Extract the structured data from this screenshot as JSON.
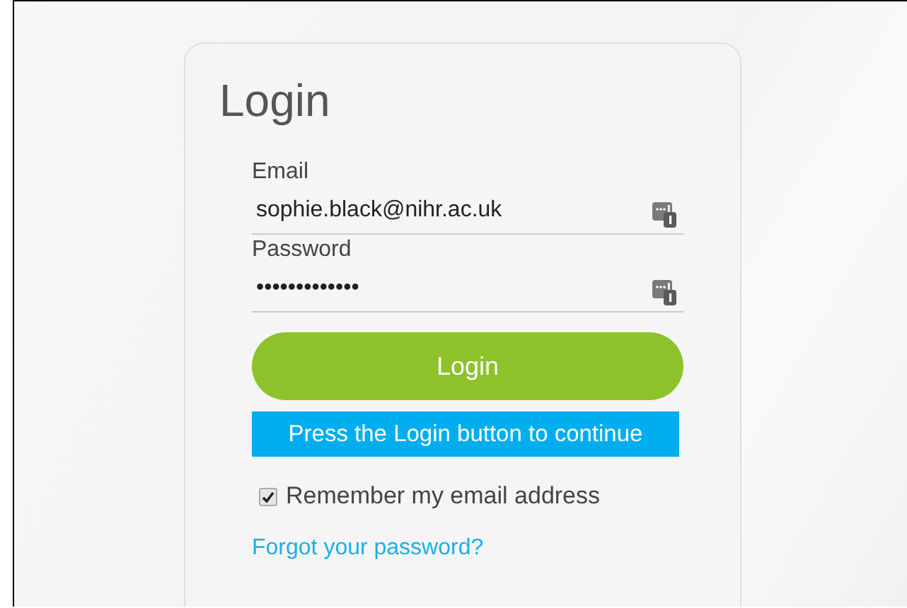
{
  "login_card": {
    "title": "Login",
    "fields": [
      {
        "label": "Email",
        "value": "sophie.black@nihr.ac.uk"
      },
      {
        "label": "Password",
        "value": "•••••••••••••"
      }
    ],
    "login_button": "Login",
    "notice": "Press the Login button to continue",
    "remember": {
      "label": "Remember my email address",
      "checked": true
    },
    "forgot_link": "Forgot your password?"
  }
}
